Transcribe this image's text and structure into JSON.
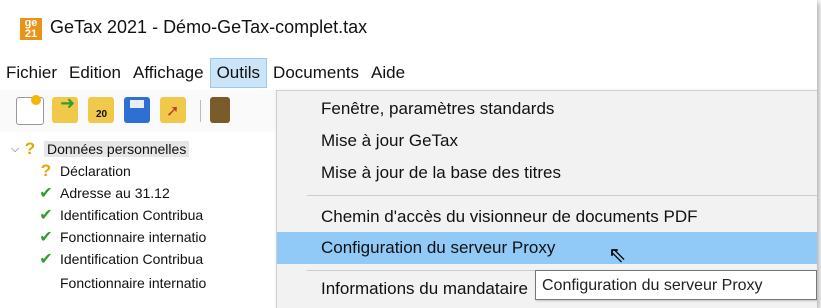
{
  "window": {
    "title": "GeTax 2021 - Démo-GeTax-complet.tax",
    "icon_text_top": "ge",
    "icon_text_bottom": "21"
  },
  "menubar": [
    "Fichier",
    "Edition",
    "Affichage",
    "Outils",
    "Documents",
    "Aide"
  ],
  "toolbar": {
    "icon_label": "20"
  },
  "tree": {
    "root": "Données personnelles",
    "items": [
      "Déclaration",
      "Adresse au 31.12",
      "Identification Contribua",
      "Fonctionnaire internatio",
      "Identification Contribua",
      "Fonctionnaire internatio"
    ]
  },
  "outils_menu": {
    "items": [
      "Fenêtre, paramètres standards",
      "Mise à jour GeTax",
      "Mise à jour de la base des titres",
      "Chemin d'accès du visionneur de documents PDF",
      "Configuration du serveur Proxy",
      "Informations du mandataire"
    ],
    "highlighted": "Configuration du serveur Proxy"
  },
  "tooltip": "Configuration du serveur Proxy",
  "colors": {
    "menu_highlight": "#91c9f7",
    "active_menu": "#cce4f7",
    "check": "#2ea02e",
    "question": "#e2a800"
  }
}
